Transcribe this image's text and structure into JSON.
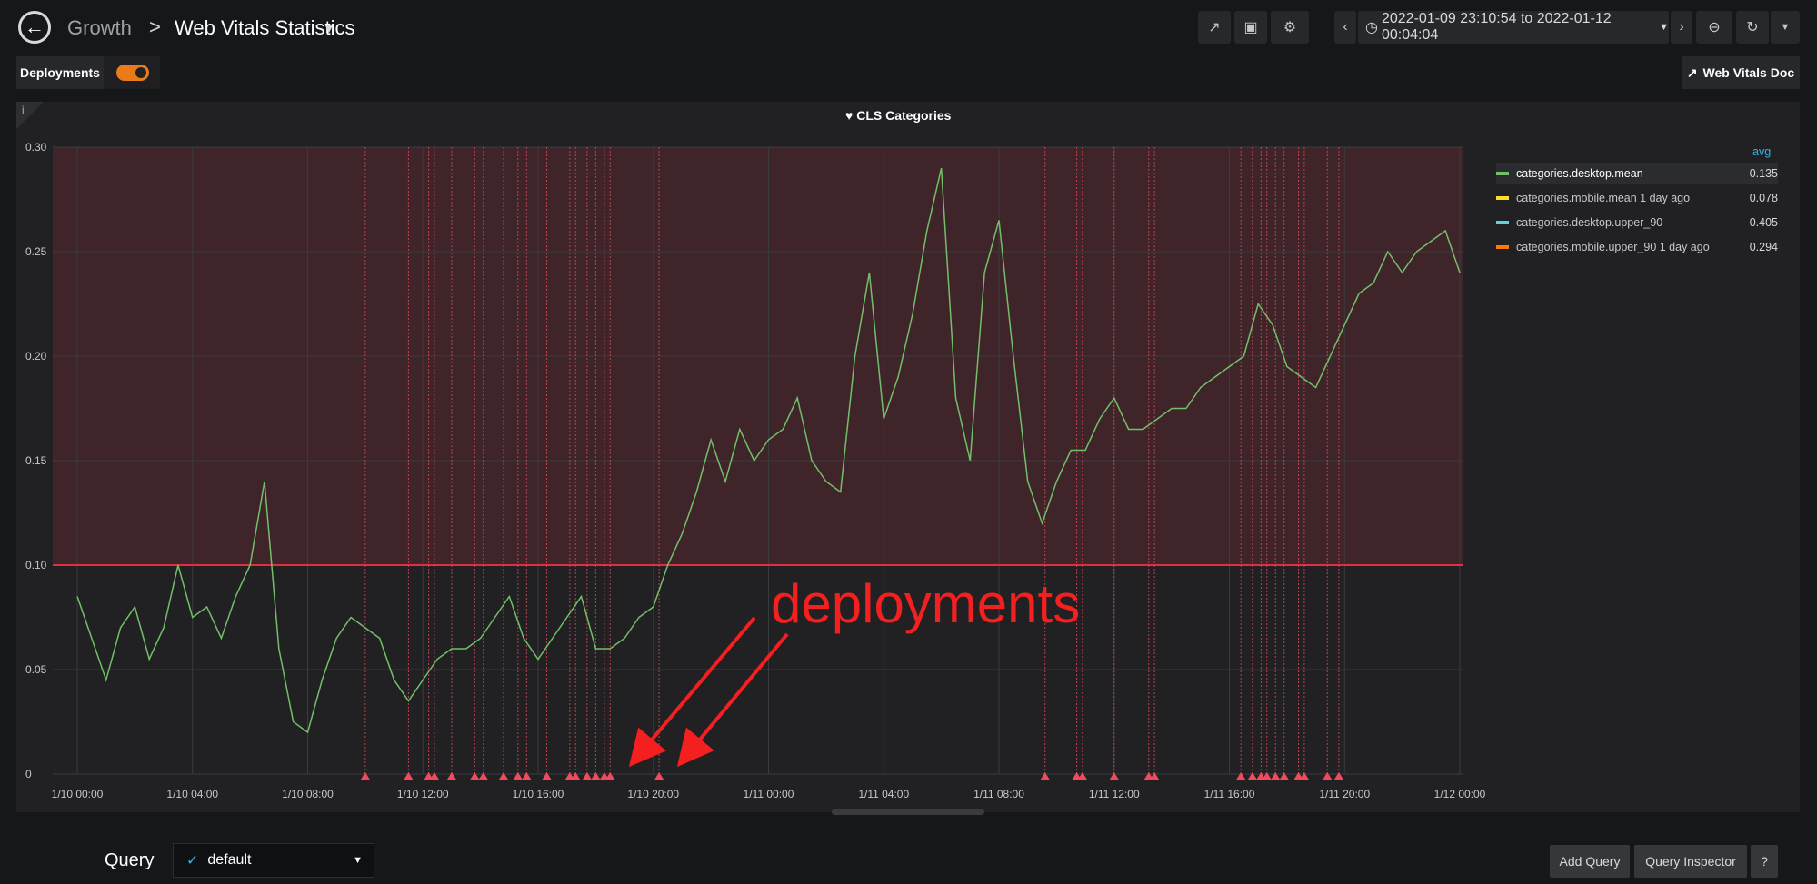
{
  "header": {
    "breadcrumb_parent": "Growth",
    "breadcrumb_separator": ">",
    "dashboard_title": "Web Vitals Statistics",
    "time_range": "2022-01-09 23:10:54 to 2022-01-12 00:04:04"
  },
  "controls": {
    "deployments_label": "Deployments",
    "deployments_enabled": true,
    "web_vitals_doc_label": "Web Vitals Doc"
  },
  "panel": {
    "info_glyph": "i",
    "title": "CLS Categories",
    "legend_header": "avg",
    "legend": [
      {
        "name": "categories.desktop.mean",
        "value": "0.135",
        "color": "#73bf69"
      },
      {
        "name": "categories.mobile.mean 1 day ago",
        "value": "0.078",
        "color": "#fade2a"
      },
      {
        "name": "categories.desktop.upper_90",
        "value": "0.405",
        "color": "#5fd2df"
      },
      {
        "name": "categories.mobile.upper_90 1 day ago",
        "value": "0.294",
        "color": "#ff780a"
      }
    ]
  },
  "annotation_text": "deployments",
  "query": {
    "label": "Query",
    "datasource": "default",
    "add_query_label": "Add Query",
    "inspector_label": "Query Inspector",
    "help_label": "?"
  },
  "chart_data": {
    "type": "line",
    "title": "CLS Categories",
    "ylim": [
      0,
      0.3
    ],
    "yticks": [
      "0",
      "0.05",
      "0.10",
      "0.15",
      "0.20",
      "0.25",
      "0.30"
    ],
    "xticks": [
      "1/10 00:00",
      "1/10 04:00",
      "1/10 08:00",
      "1/10 12:00",
      "1/10 16:00",
      "1/10 20:00",
      "1/11 00:00",
      "1/11 04:00",
      "1/11 08:00",
      "1/11 12:00",
      "1/11 16:00",
      "1/11 20:00",
      "1/12 00:00"
    ],
    "threshold": 0.1,
    "series": [
      {
        "name": "categories.desktop.mean",
        "color": "#73bf69",
        "x_hours": [
          0,
          0.5,
          1,
          1.5,
          2,
          2.5,
          3,
          3.5,
          4,
          4.5,
          5,
          5.5,
          6,
          6.5,
          7,
          7.5,
          8,
          8.5,
          9,
          9.5,
          10,
          10.5,
          11,
          11.5,
          12,
          12.5,
          13,
          13.5,
          14,
          14.5,
          15,
          15.5,
          16,
          16.5,
          17,
          17.5,
          18,
          18.5,
          19,
          19.5,
          20,
          20.5,
          21,
          21.5,
          22,
          22.5,
          23,
          23.5,
          24,
          24.5,
          25,
          25.5,
          26,
          26.5,
          27,
          27.5,
          28,
          28.5,
          29,
          29.5,
          30,
          30.5,
          31,
          31.5,
          32,
          32.5,
          33,
          33.5,
          34,
          34.5,
          35,
          35.5,
          36,
          36.5,
          37,
          37.5,
          38,
          38.5,
          39,
          39.5,
          40,
          40.5,
          41,
          41.5,
          42,
          42.5,
          43,
          43.5,
          44,
          44.5,
          45,
          45.5,
          46,
          46.5,
          47,
          47.5,
          48
        ],
        "values": [
          0.085,
          0.065,
          0.045,
          0.07,
          0.08,
          0.055,
          0.07,
          0.1,
          0.075,
          0.08,
          0.065,
          0.085,
          0.1,
          0.14,
          0.06,
          0.025,
          0.02,
          0.045,
          0.065,
          0.075,
          0.07,
          0.065,
          0.045,
          0.035,
          0.045,
          0.055,
          0.06,
          0.06,
          0.065,
          0.075,
          0.085,
          0.065,
          0.055,
          0.065,
          0.075,
          0.085,
          0.06,
          0.06,
          0.065,
          0.075,
          0.08,
          0.1,
          0.115,
          0.135,
          0.16,
          0.14,
          0.165,
          0.15,
          0.16,
          0.165,
          0.18,
          0.15,
          0.14,
          0.135,
          0.2,
          0.24,
          0.17,
          0.19,
          0.22,
          0.26,
          0.29,
          0.18,
          0.15,
          0.24,
          0.265,
          0.2,
          0.14,
          0.12,
          0.14,
          0.155,
          0.155,
          0.17,
          0.18,
          0.165,
          0.165,
          0.17,
          0.175,
          0.175,
          0.185,
          0.19,
          0.195,
          0.2,
          0.225,
          0.215,
          0.195,
          0.19,
          0.185,
          0.2,
          0.215,
          0.23,
          0.235,
          0.25,
          0.24,
          0.25,
          0.255,
          0.26,
          0.24
        ]
      }
    ],
    "deployment_hours": [
      10.0,
      11.5,
      12.2,
      12.4,
      13.0,
      13.8,
      14.1,
      14.8,
      15.3,
      15.6,
      16.3,
      17.1,
      17.3,
      17.7,
      18.0,
      18.3,
      18.5,
      20.2,
      33.6,
      34.7,
      34.9,
      36.0,
      37.2,
      37.4,
      40.4,
      40.8,
      41.1,
      41.3,
      41.6,
      41.9,
      42.4,
      42.6,
      43.4,
      43.8
    ]
  }
}
